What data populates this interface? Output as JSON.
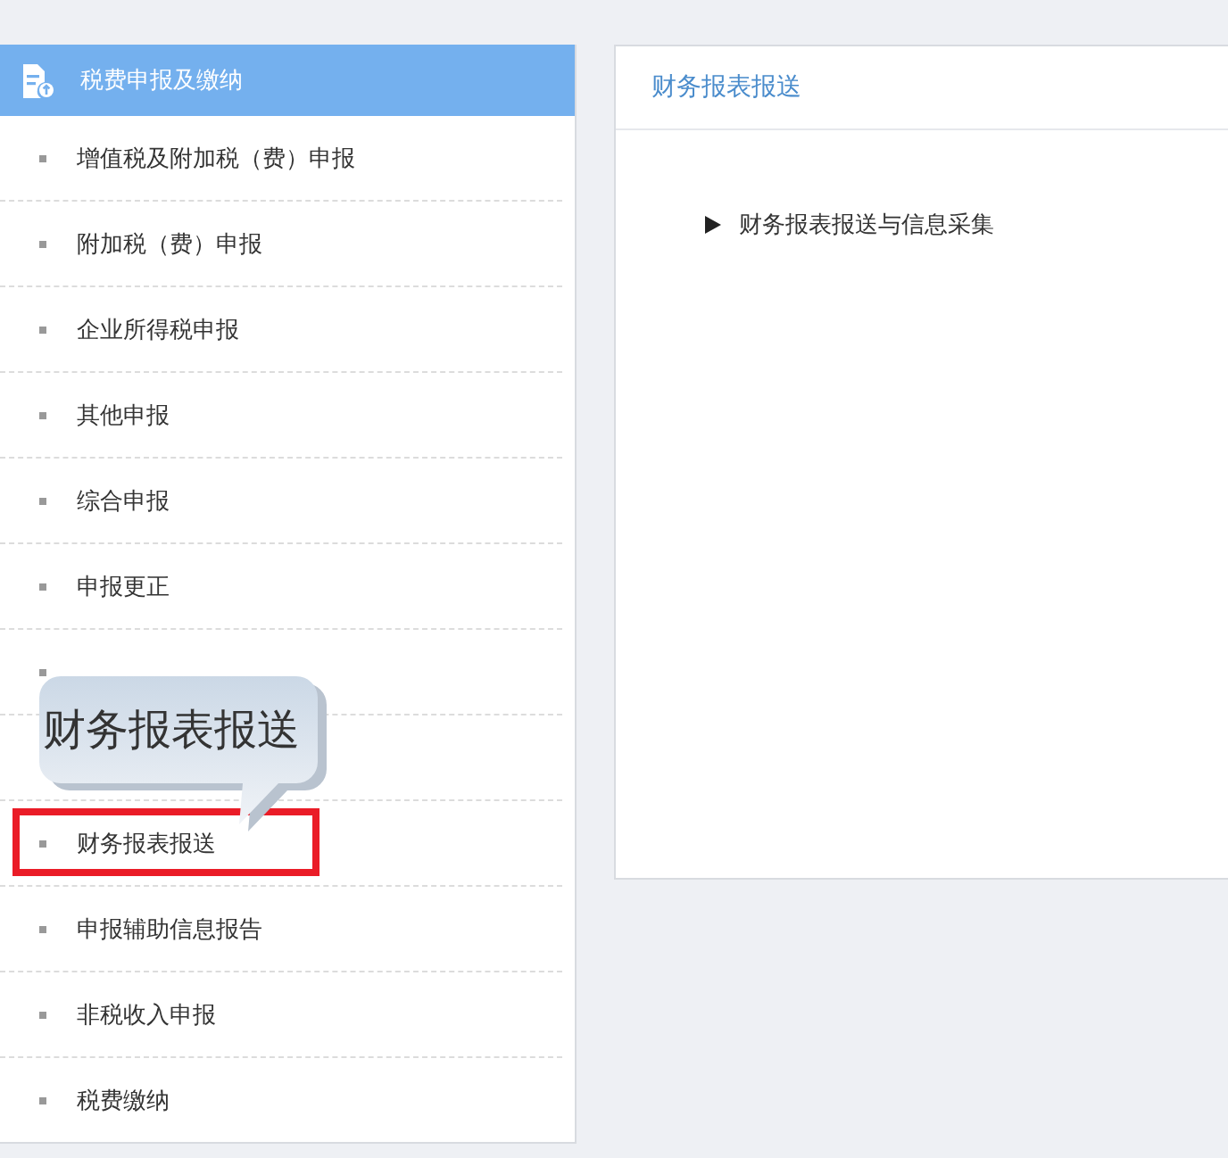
{
  "sidebar": {
    "title": "税费申报及缴纳",
    "items": [
      {
        "label": "增值税及附加税（费）申报",
        "highlighted": false
      },
      {
        "label": "附加税（费）申报",
        "highlighted": false
      },
      {
        "label": "企业所得税申报",
        "highlighted": false
      },
      {
        "label": "其他申报",
        "highlighted": false
      },
      {
        "label": "综合申报",
        "highlighted": false
      },
      {
        "label": "申报更正",
        "highlighted": false
      },
      {
        "highlighted": false
      },
      {
        "highlighted": false
      },
      {
        "label": "财务报表报送",
        "highlighted": true
      },
      {
        "label": "申报辅助信息报告",
        "highlighted": false
      },
      {
        "label": "非税收入申报",
        "highlighted": false
      },
      {
        "label": "税费缴纳",
        "highlighted": false
      }
    ]
  },
  "callout": {
    "text": "财务报表报送"
  },
  "panel": {
    "title": "财务报表报送",
    "links": [
      {
        "label": "财务报表报送与信息采集",
        "expanded": false
      }
    ]
  }
}
